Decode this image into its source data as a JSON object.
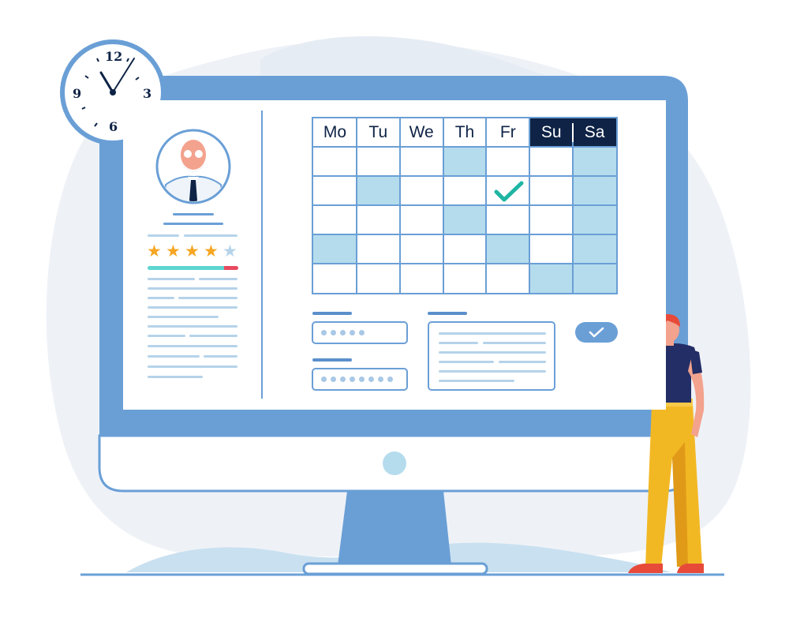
{
  "calendar": {
    "days": [
      "Mo",
      "Tu",
      "We",
      "Th",
      "Fr",
      "Su",
      "Sa"
    ],
    "weekend_indices": [
      5,
      6
    ],
    "rows": 5,
    "shaded_cells": [
      [
        0,
        3
      ],
      [
        0,
        6
      ],
      [
        1,
        1
      ],
      [
        1,
        6
      ],
      [
        2,
        3
      ],
      [
        2,
        6
      ],
      [
        3,
        0
      ],
      [
        3,
        4
      ],
      [
        3,
        6
      ],
      [
        4,
        5
      ],
      [
        4,
        6
      ]
    ],
    "checked_cell": [
      1,
      4
    ]
  },
  "clock": {
    "numbers": {
      "n12": "12",
      "n3": "3",
      "n6": "6",
      "n9": "9"
    }
  },
  "rating": {
    "value": 4,
    "max": 5
  },
  "progress": {
    "fraction": 0.85
  },
  "colors": {
    "navy": "#0e2346",
    "accent_blue": "#6a9fd6",
    "light_blue": "#b5dced",
    "star": "#f5a623",
    "progress_fill": "#5fd6d0",
    "progress_end": "#e84a5f",
    "check_green": "#1fb5a3"
  },
  "icons": {
    "clock": "wall-clock-icon",
    "avatar": "doctor-avatar-icon",
    "check": "check-icon",
    "confirm": "check-button-icon"
  }
}
